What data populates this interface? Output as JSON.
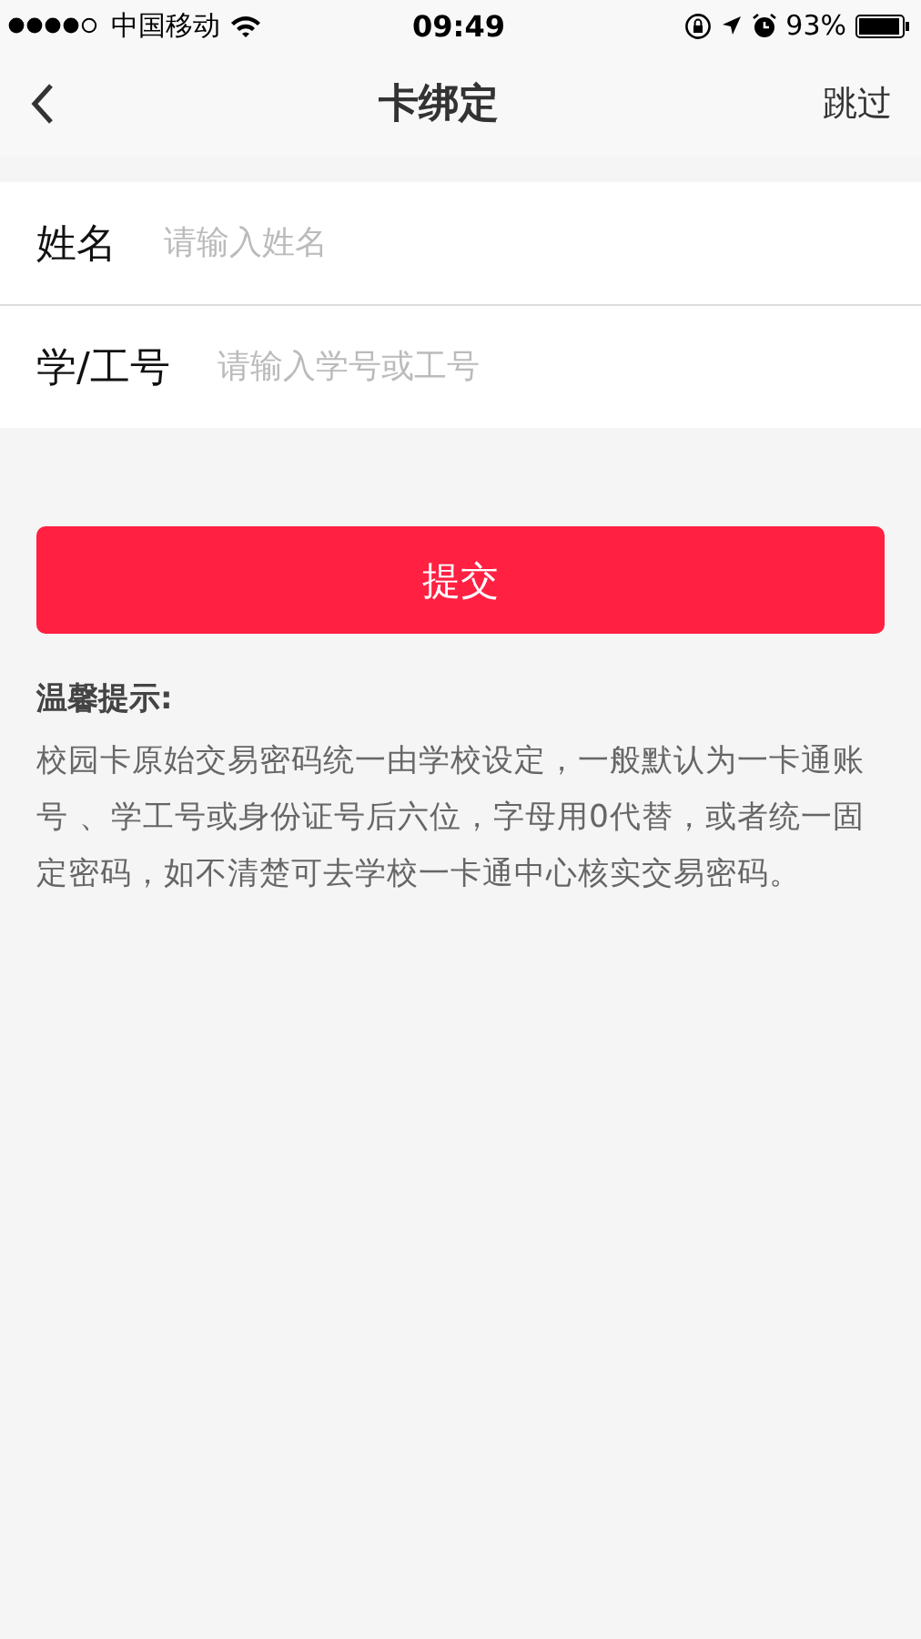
{
  "status_bar": {
    "carrier": "中国移动",
    "time": "09:49",
    "battery": "93%"
  },
  "nav": {
    "title": "卡绑定",
    "action": "跳过"
  },
  "fields": [
    {
      "label": "姓名",
      "placeholder": "请输入姓名"
    },
    {
      "label": "学/工号",
      "placeholder": "请输入学号或工号"
    }
  ],
  "submit": "提交",
  "tip": {
    "title": "温馨提示:",
    "body": "校园卡原始交易密码统一由学校设定，一般默认为一卡通账号 、学工号或身份证号后六位，字母用0代替，或者统一固定密码，如不清楚可去学校一卡通中心核实交易密码。"
  }
}
